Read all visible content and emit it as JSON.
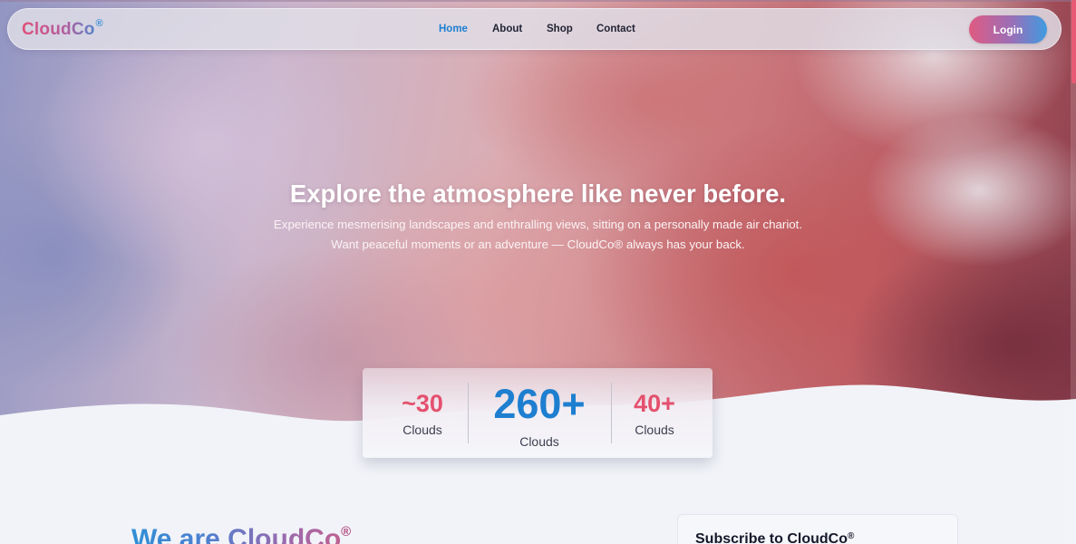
{
  "brand": {
    "name": "CloudCo",
    "mark": "®"
  },
  "nav": {
    "items": [
      {
        "label": "Home",
        "active": true
      },
      {
        "label": "About",
        "active": false
      },
      {
        "label": "Shop",
        "active": false
      },
      {
        "label": "Contact",
        "active": false
      }
    ],
    "login_label": "Login"
  },
  "hero": {
    "title": "Explore the atmosphere like never before.",
    "subtitle_line1": "Experience mesmerising landscapes and enthralling views, sitting on a personally made air chariot.",
    "subtitle_line2": "Want peaceful moments or an adventure — CloudCo® always has your back."
  },
  "stats": [
    {
      "value": "~30",
      "label": "Clouds"
    },
    {
      "value": "260+",
      "label": "Clouds"
    },
    {
      "value": "40+",
      "label": "Clouds"
    }
  ],
  "about": {
    "title": "We are CloudCo",
    "mark": "®"
  },
  "subscribe": {
    "title": "Subscribe to CloudCo",
    "mark": "®"
  },
  "colors": {
    "accent_blue": "#1e7fd0",
    "accent_pink": "#e4506e",
    "page_background": "#f1f3f8"
  }
}
